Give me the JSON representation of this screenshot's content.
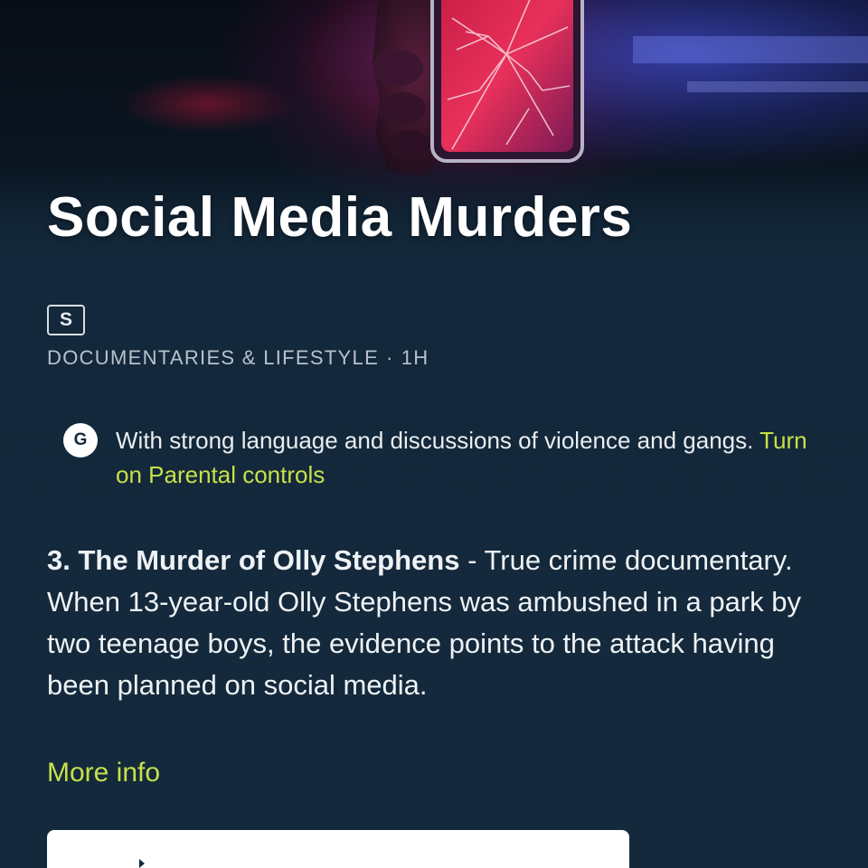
{
  "show": {
    "title": "Social Media Murders",
    "rating_badge": "S",
    "genre": "DOCUMENTARIES & LIFESTYLE",
    "separator": "·",
    "duration": "1H"
  },
  "guidance": {
    "badge": "G",
    "text": "With strong language and discussions of violence and gangs.",
    "link_label": "Turn on Parental controls"
  },
  "episode": {
    "title": "3. The Murder of Olly Stephens",
    "dash": " - ",
    "synopsis": "True crime documentary. When 13-year-old Olly Stephens was ambushed in a park by two teenage boys, the evidence points to the attack having been planned on social media."
  },
  "more_info_label": "More info",
  "colors": {
    "background": "#13283a",
    "accent_link": "#c7e04a",
    "text_primary": "#ffffff",
    "text_meta": "#b8c2cc",
    "cta_background": "#ffffff"
  },
  "icons": {
    "guidance": "guidance-g-icon",
    "hero": "cracked-phone-artwork"
  }
}
